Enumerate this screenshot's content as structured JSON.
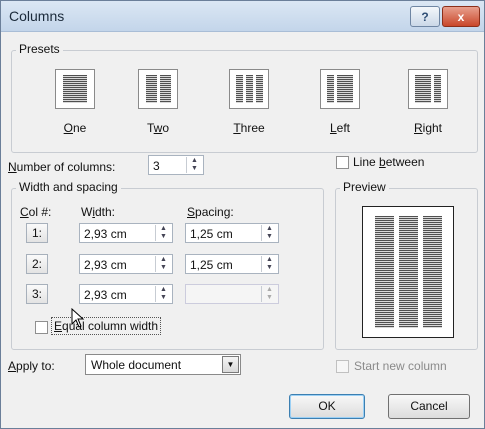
{
  "window": {
    "title": "Columns",
    "help_icon": "?",
    "close_icon": "x"
  },
  "presets": {
    "label": "Presets",
    "items": [
      {
        "label": "One",
        "accel": "O",
        "rest": "ne",
        "cols": 1
      },
      {
        "label": "Two",
        "pre": "T",
        "accel": "w",
        "rest": "o",
        "cols": 2
      },
      {
        "label": "Three",
        "accel": "T",
        "rest": "hree",
        "cols": 3
      },
      {
        "label": "Left",
        "accel": "L",
        "rest": "eft",
        "cols": 2
      },
      {
        "label": "Right",
        "accel": "R",
        "rest": "ight",
        "cols": 2
      }
    ]
  },
  "num_columns": {
    "accel": "N",
    "rest": "umber of columns:",
    "value": "3"
  },
  "line_between": {
    "pre": "Line ",
    "accel": "b",
    "rest": "etween",
    "checked": false
  },
  "width_spacing": {
    "label": "Width and spacing",
    "col_header": {
      "accel": "C",
      "rest": "ol #:"
    },
    "width_header": {
      "pre": "W",
      "accel": "i",
      "rest": "dth:"
    },
    "spacing_header": {
      "accel": "S",
      "rest": "pacing:"
    },
    "rows": [
      {
        "col": "1:",
        "width": "2,93 cm",
        "spacing": "1,25 cm"
      },
      {
        "col": "2:",
        "width": "2,93 cm",
        "spacing": "1,25 cm"
      },
      {
        "col": "3:",
        "width": "2,93 cm",
        "spacing": ""
      }
    ],
    "equal_width": {
      "label": "Equal column width",
      "accel": "E",
      "rest": "qual column width",
      "checked": false
    }
  },
  "preview": {
    "label": "Preview"
  },
  "apply_to": {
    "accel": "A",
    "rest": "pply to:",
    "value": "Whole document"
  },
  "start_new_column": {
    "label": "Start new column",
    "enabled": false
  },
  "buttons": {
    "ok": "OK",
    "cancel": "Cancel"
  },
  "colors": {
    "title_bar": "#c3d5ea",
    "close_button": "#c9472a",
    "default_button_border": "#3c7fb1"
  }
}
